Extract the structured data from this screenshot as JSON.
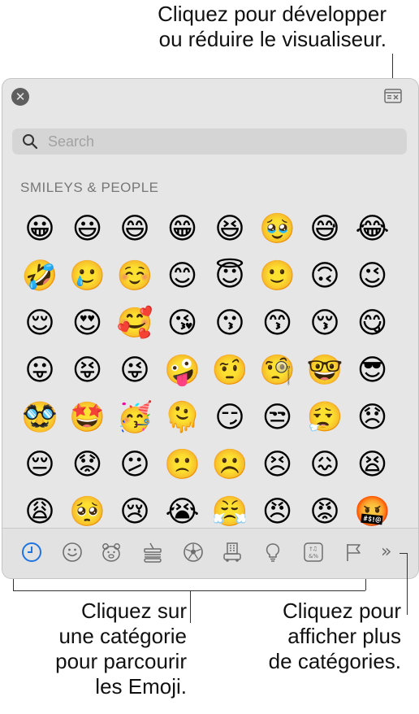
{
  "callouts": {
    "top": [
      "Cliquez pour développer",
      "ou réduire le visualiseur."
    ],
    "left": [
      "Cliquez sur",
      "une catégorie",
      "pour parcourir",
      "les Emoji."
    ],
    "right": [
      "Cliquez pour",
      "afficher plus",
      "de catégories."
    ]
  },
  "panel": {
    "search_placeholder": "Search",
    "section_title": "SMILEYS & PEOPLE",
    "emojis": [
      "😀",
      "😃",
      "😄",
      "😁",
      "😆",
      "🥹",
      "😅",
      "😂",
      "🤣",
      "🥲",
      "☺️",
      "😊",
      "😇",
      "🙂",
      "🙃",
      "😉",
      "😌",
      "😍",
      "🥰",
      "😘",
      "😗",
      "😙",
      "😚",
      "😋",
      "😛",
      "😝",
      "😜",
      "🤪",
      "🤨",
      "🧐",
      "🤓",
      "😎",
      "🥸",
      "🤩",
      "🥳",
      "🫠",
      "😏",
      "😒",
      "😮‍💨",
      "😞",
      "😔",
      "😟",
      "😕",
      "🙁",
      "☹️",
      "😣",
      "😖",
      "😫",
      "😩",
      "🥺",
      "😢",
      "😭",
      "😤",
      "😠",
      "😡",
      "🤬"
    ],
    "categories": [
      {
        "name": "recent",
        "icon": "clock-icon"
      },
      {
        "name": "smileys",
        "icon": "smiley-icon"
      },
      {
        "name": "animals",
        "icon": "bear-icon"
      },
      {
        "name": "food",
        "icon": "burger-icon"
      },
      {
        "name": "activity",
        "icon": "soccer-ball-icon"
      },
      {
        "name": "travel",
        "icon": "buildings-icon"
      },
      {
        "name": "objects",
        "icon": "lightbulb-icon"
      },
      {
        "name": "symbols",
        "icon": "symbols-icon"
      },
      {
        "name": "flags",
        "icon": "flag-icon"
      }
    ],
    "more_label": "»"
  },
  "colors": {
    "accent": "#1f73e0",
    "icon_gray": "#6e6e6e"
  }
}
